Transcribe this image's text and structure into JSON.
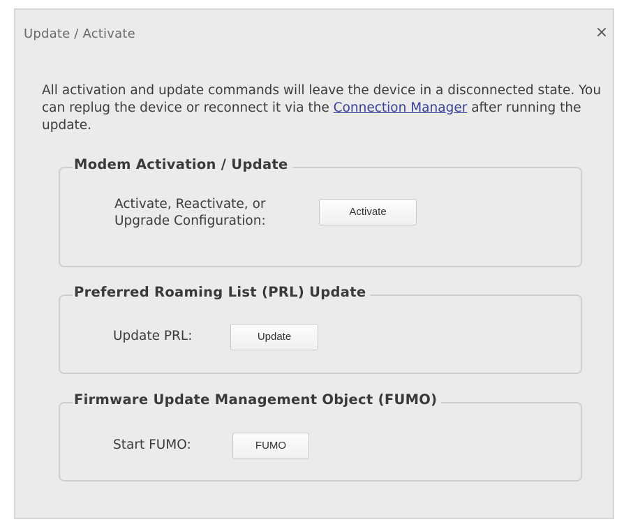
{
  "dialog": {
    "title": "Update / Activate",
    "close_glyph": "×"
  },
  "info": {
    "text_before_link": "All activation and update commands will leave the device in a disconnected state. You can replug the device or reconnect it via the ",
    "link_text": "Connection Manager",
    "text_after_link": " after running the update."
  },
  "groups": [
    {
      "legend": "Modem Activation / Update",
      "label_line1": "Activate, Reactivate, or",
      "label_line2": "Upgrade Configuration:",
      "button_label": "Activate"
    },
    {
      "legend": "Preferred Roaming List (PRL) Update",
      "label": "Update PRL:",
      "button_label": "Update"
    },
    {
      "legend": "Firmware Update Management Object (FUMO)",
      "label": "Start FUMO:",
      "button_label": "FUMO"
    }
  ],
  "colors": {
    "dialog_bg": "#ebebeb",
    "link": "#3a3f9a",
    "group_border": "#cfcfcf"
  },
  "icons": {
    "close": "close-icon"
  }
}
